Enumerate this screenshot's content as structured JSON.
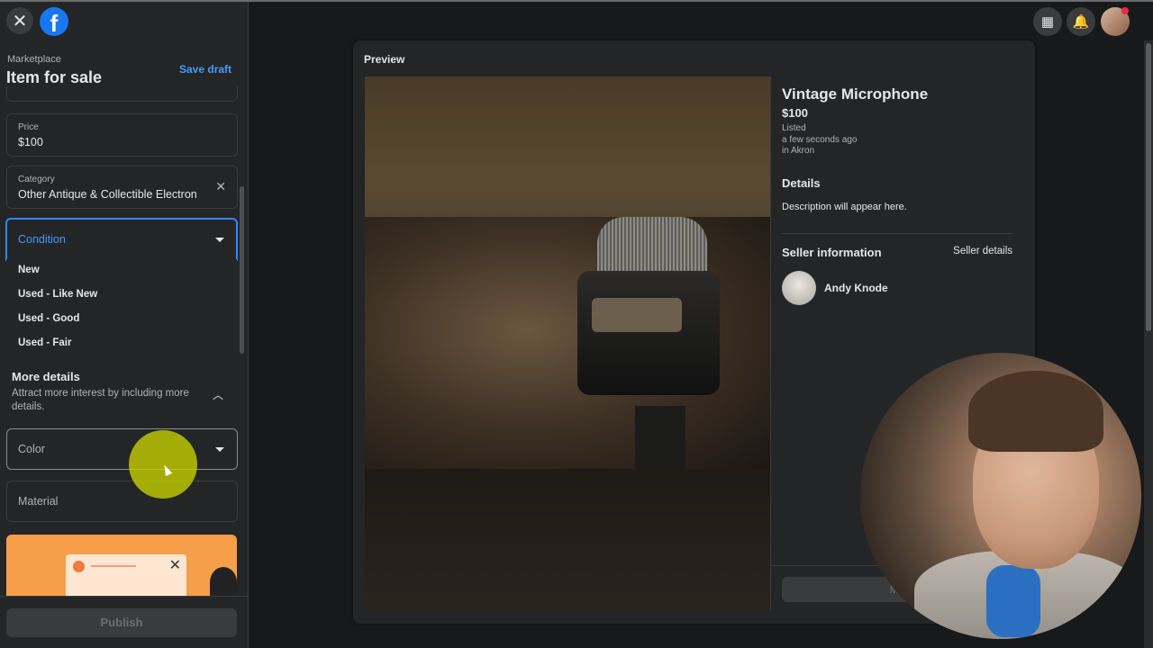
{
  "header": {
    "close_icon": "close-icon",
    "logo": "f",
    "breadcrumb": "Marketplace",
    "title": "Item for sale",
    "save_draft": "Save draft"
  },
  "form": {
    "price": {
      "label": "Price",
      "value": "$100"
    },
    "category": {
      "label": "Category",
      "value": "Other Antique & Collectible Electron"
    },
    "condition": {
      "placeholder": "Condition"
    },
    "condition_options": [
      "New",
      "Used - Like New",
      "Used - Good",
      "Used - Fair"
    ],
    "more_details": {
      "title": "More details",
      "description": "Attract more interest by including more details."
    },
    "color": {
      "placeholder": "Color"
    },
    "material": {
      "placeholder": "Material"
    },
    "publish": "Publish"
  },
  "preview": {
    "label": "Preview",
    "item_title": "Vintage Microphone",
    "price": "$100",
    "listed": "Listed",
    "listed_time": "a few seconds ago",
    "location": "in Akron",
    "details_title": "Details",
    "description": "Description will appear here.",
    "seller_title": "Seller information",
    "seller_details": "Seller details",
    "seller_name": "Andy Knode",
    "message_button": "Me"
  },
  "topbar": {
    "icons": [
      "menu-grid-icon",
      "notifications-icon",
      "account-avatar"
    ]
  },
  "colors": {
    "accent": "#2d88ff",
    "link": "#4599ff",
    "background": "#18191a",
    "panel": "#242526",
    "brand": "#1877f2"
  }
}
